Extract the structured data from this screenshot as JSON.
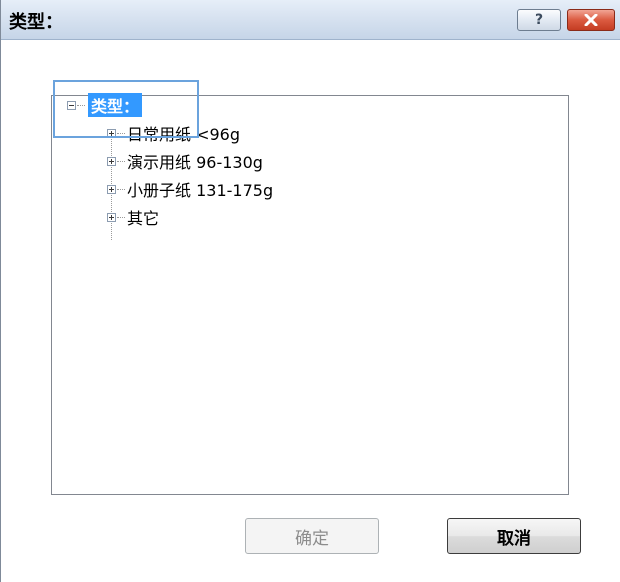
{
  "window": {
    "title": "类型：",
    "help_glyph": "?",
    "close_glyph": "✕"
  },
  "tree": {
    "root": {
      "label": "类型：",
      "expanded": true
    },
    "children": [
      {
        "label": "日常用纸 <96g",
        "expanded": false
      },
      {
        "label": "演示用纸 96-130g",
        "expanded": false
      },
      {
        "label": "小册子纸 131-175g",
        "expanded": false
      },
      {
        "label": "其它",
        "expanded": false
      }
    ]
  },
  "buttons": {
    "ok_label": "确定",
    "cancel_label": "取消"
  },
  "colors": {
    "selection": "#3399ff",
    "close_button": "#db5a40"
  }
}
